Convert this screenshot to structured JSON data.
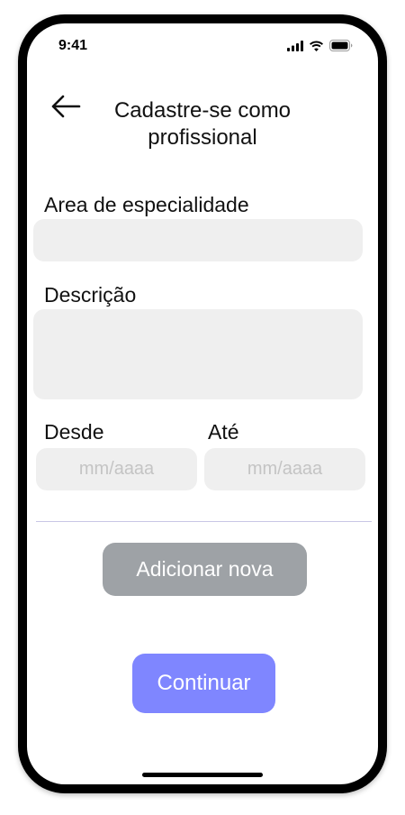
{
  "status_bar": {
    "time": "9:41",
    "icons": [
      "cellular-signal-icon",
      "wifi-icon",
      "battery-icon"
    ]
  },
  "header": {
    "back_icon": "arrow-left-icon",
    "title": "Cadastre-se como profissional"
  },
  "form": {
    "specialty_label": "Area de especialidade",
    "specialty_value": "",
    "description_label": "Descrição",
    "description_value": "",
    "from_label": "Desde",
    "from_placeholder": "mm/aaaa",
    "to_label": "Até",
    "to_placeholder": "mm/aaaa"
  },
  "actions": {
    "add_new_label": "Adicionar nova",
    "continue_label": "Continuar"
  },
  "colors": {
    "field_background": "#efefef",
    "add_button": "#9ea2a6",
    "continue_button": "#7f86ff",
    "divider": "#c9c6e6"
  }
}
